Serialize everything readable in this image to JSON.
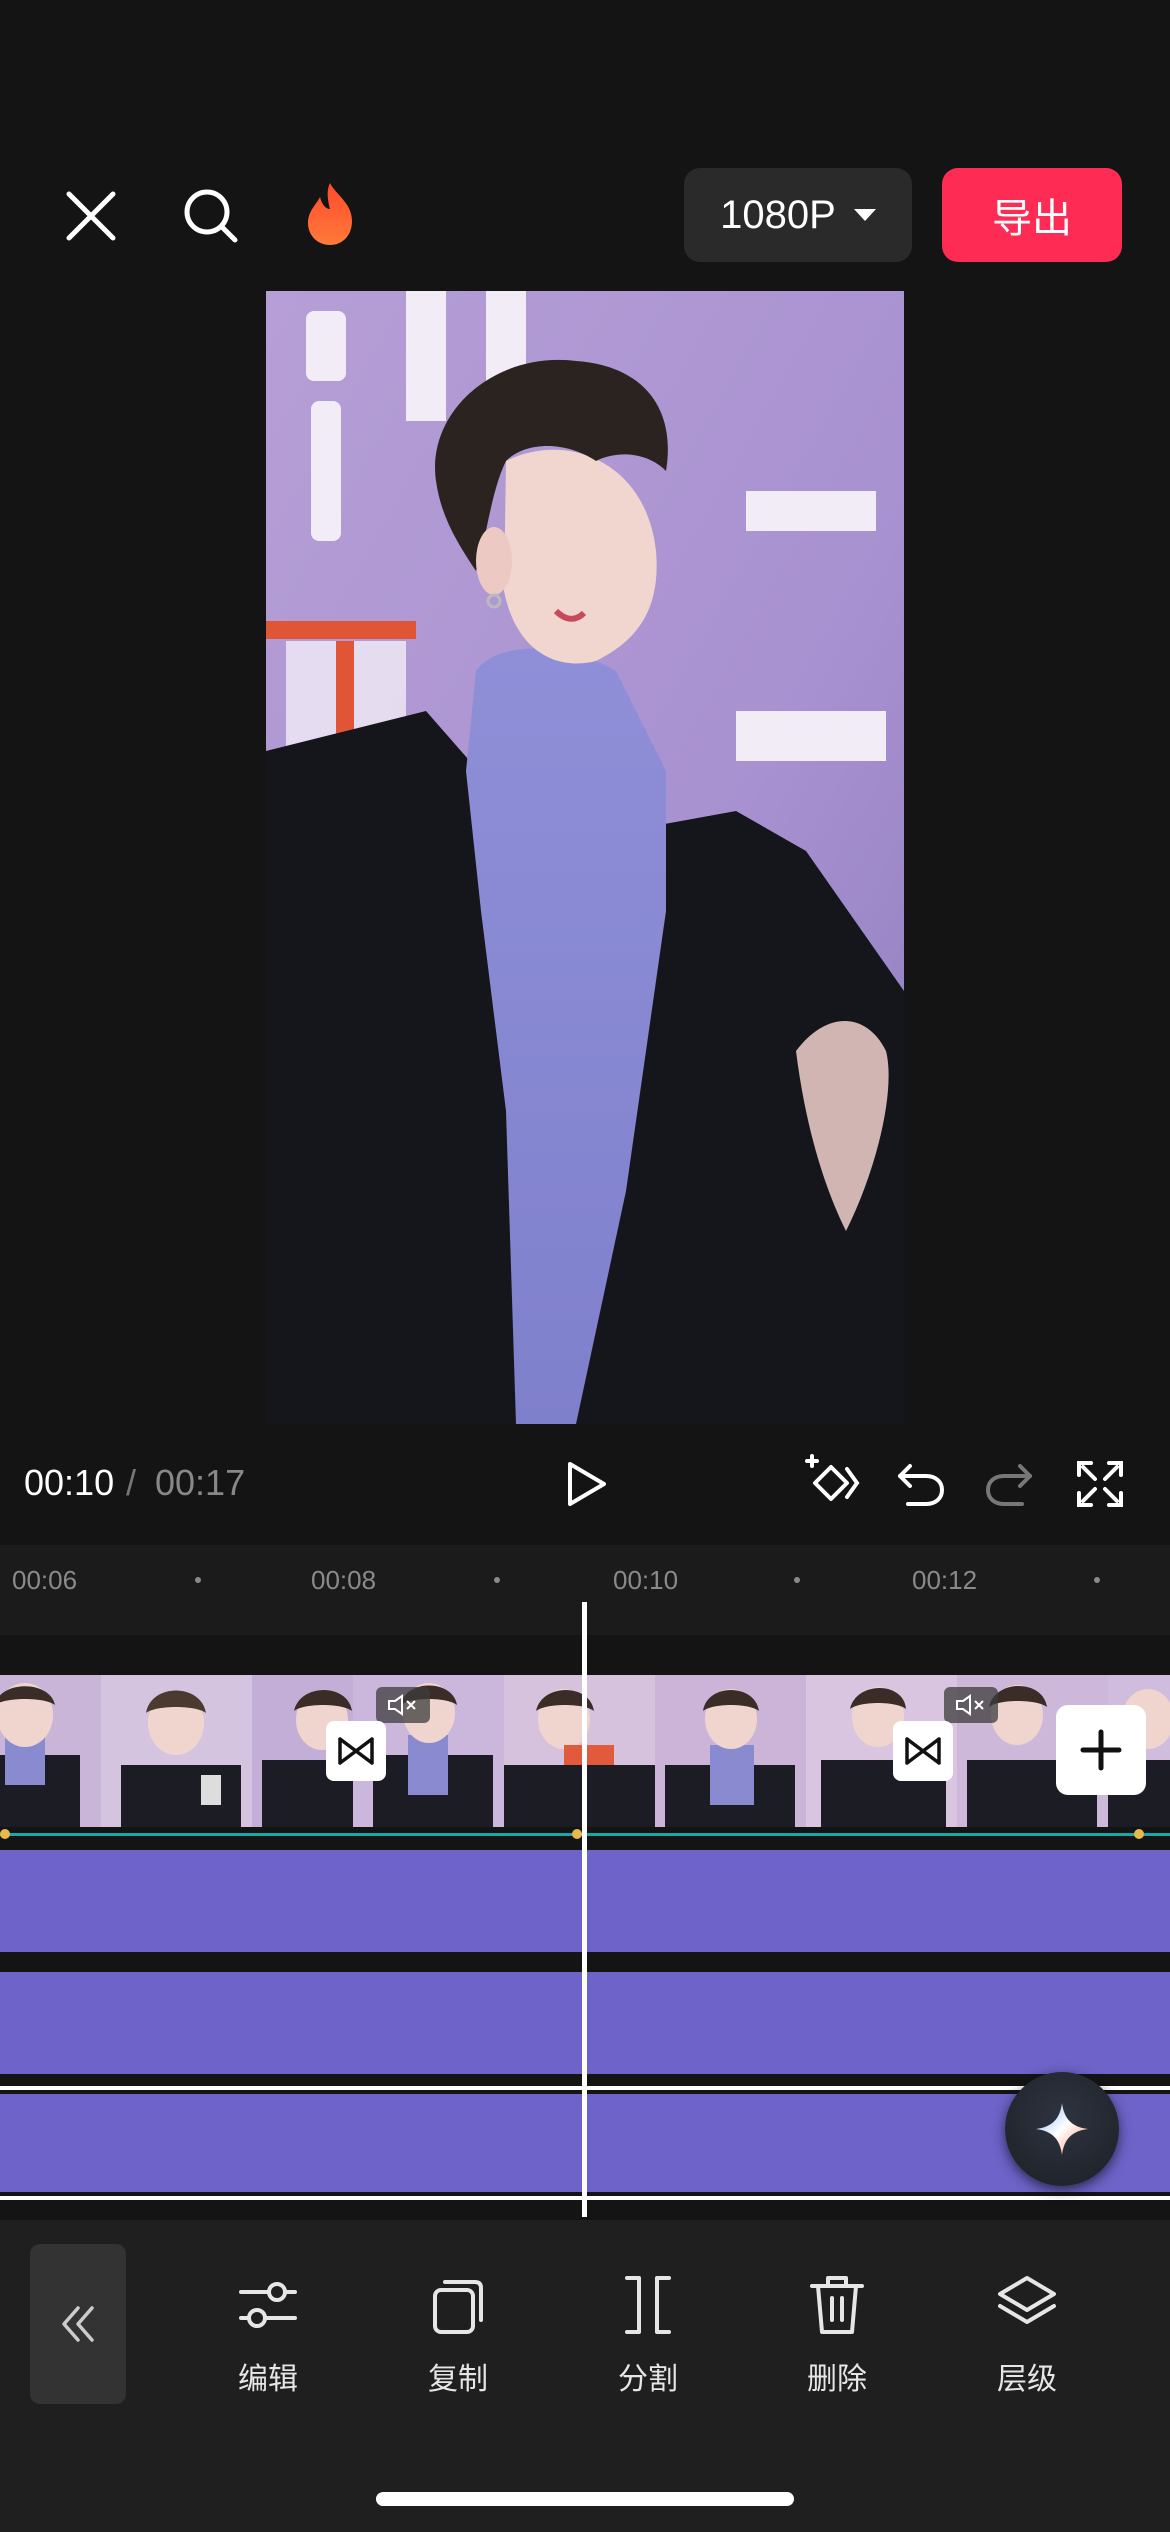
{
  "topbar": {
    "close_icon": "close-icon",
    "search_icon": "search-icon",
    "hot_icon": "fire-icon",
    "resolution": "1080P",
    "export_label": "导出",
    "export_color": "#fe2c55"
  },
  "player": {
    "current_time": "00:10",
    "separator": "/",
    "total_time": "00:17"
  },
  "ruler": {
    "labels": [
      "00:06",
      "00:08",
      "00:10",
      "00:12"
    ]
  },
  "timeline": {
    "track_color": "#6d63c8",
    "clip_count_visible": 8
  },
  "toolbar": {
    "items": [
      {
        "label": "编辑",
        "icon": "sliders-icon"
      },
      {
        "label": "复制",
        "icon": "copy-icon"
      },
      {
        "label": "分割",
        "icon": "split-icon"
      },
      {
        "label": "删除",
        "icon": "trash-icon"
      },
      {
        "label": "层级",
        "icon": "layers-icon"
      }
    ]
  }
}
